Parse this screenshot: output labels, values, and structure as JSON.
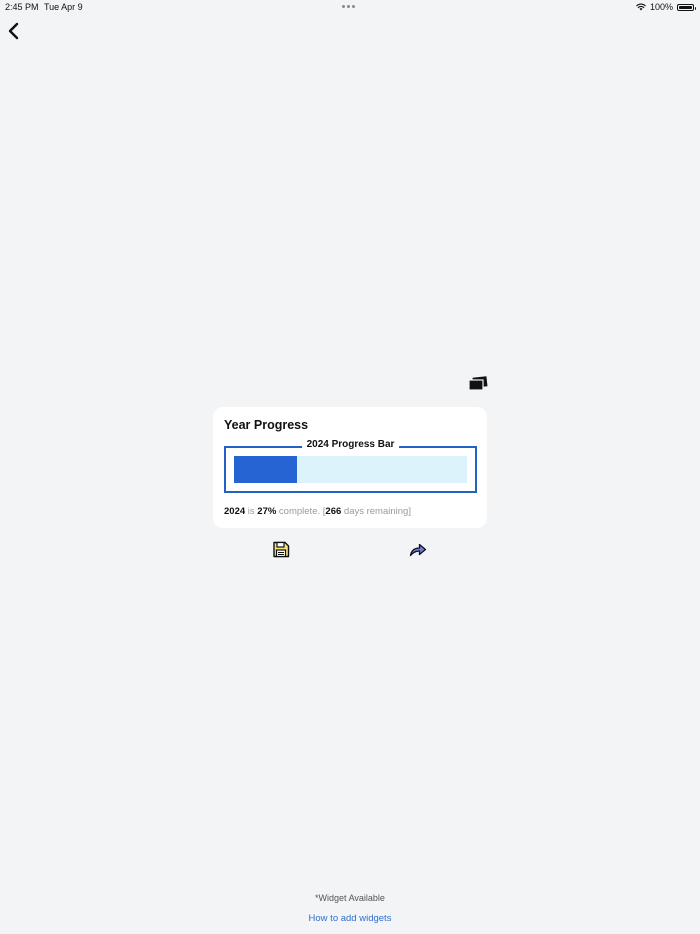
{
  "status_bar": {
    "time": "2:45 PM",
    "date": "Tue Apr 9",
    "battery": "100%"
  },
  "nav": {
    "back_icon": "chevron-left-icon"
  },
  "actions": {
    "cards_icon": "stacked-cards-icon",
    "save_icon": "floppy-disk-icon",
    "share_icon": "share-arrow-icon"
  },
  "widget": {
    "title": "Year Progress",
    "bar_label": "2024 Progress Bar",
    "progress_fraction": 0.27,
    "colors": {
      "frame": "#2460c6",
      "fill": "#2664d4",
      "track": "#dcf3fb"
    },
    "summary": {
      "year": "2024",
      "is_text": " is ",
      "percent": "27%",
      "complete_text": " complete. [",
      "days": "266",
      "days_text": " days remaining]"
    }
  },
  "footer": {
    "note": "*Widget Available",
    "link": "How to add widgets"
  }
}
